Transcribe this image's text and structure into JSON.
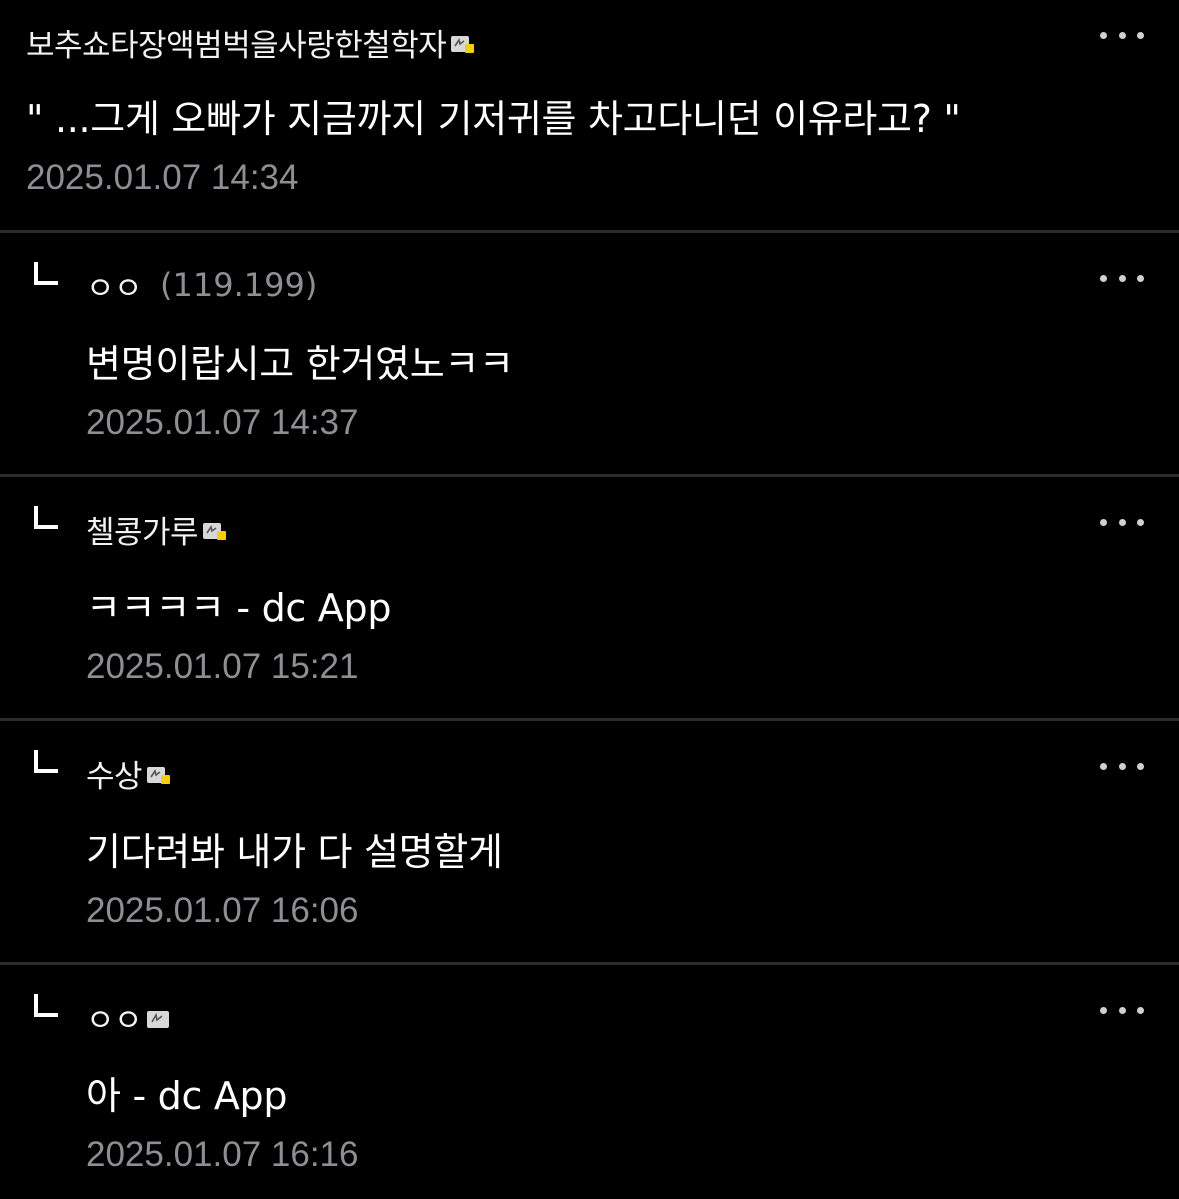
{
  "comments": [
    {
      "nickname": "보추쇼타장액범벅을사랑한철학자",
      "has_badge": true,
      "is_reply": false,
      "ip": "",
      "text": "\" ...그게 오빠가 지금까지 기저귀를 차고다니던 이유라고? \"",
      "date": "2025.01.07 14:34"
    },
    {
      "nickname": "ㅇㅇ",
      "has_badge": false,
      "is_reply": true,
      "ip": "(119.199)",
      "text": "변명이랍시고 한거였노ㅋㅋ",
      "date": "2025.01.07 14:37"
    },
    {
      "nickname": "첼콩가루",
      "has_badge": true,
      "is_reply": true,
      "ip": "",
      "text": "ㅋㅋㅋㅋ - dc App",
      "date": "2025.01.07 15:21"
    },
    {
      "nickname": "수상",
      "has_badge": true,
      "is_reply": true,
      "ip": "",
      "text": "기다려봐 내가 다 설명할게",
      "date": "2025.01.07 16:06"
    },
    {
      "nickname": "ㅇㅇ",
      "has_badge": true,
      "is_reply": true,
      "ip": "",
      "text": "아 - dc App",
      "date": "2025.01.07 16:16"
    }
  ],
  "icons": {
    "more": "more-options-icon",
    "reply": "reply-arrow-icon",
    "badge": "gallery-member-badge-icon"
  },
  "colors": {
    "background": "#000000",
    "divider": "#2c2c2e",
    "text": "#ffffff",
    "meta": "#8e8e93",
    "badge_accent": "#f5d000"
  }
}
